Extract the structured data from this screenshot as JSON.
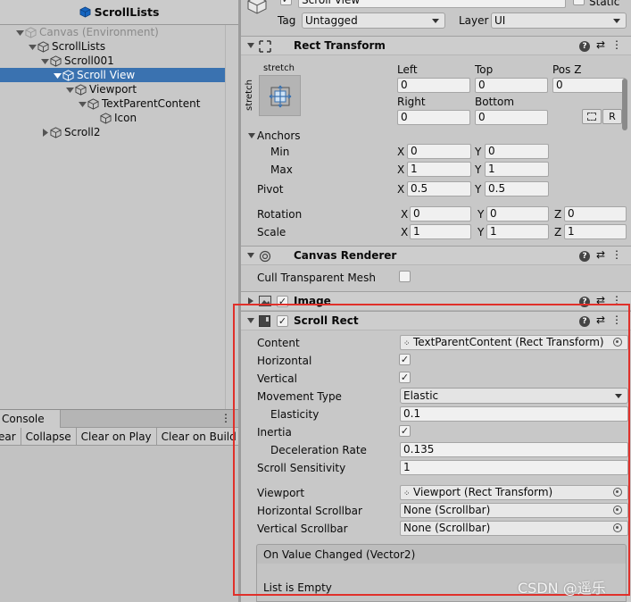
{
  "hierarchy": {
    "title": "ScrollLists",
    "items": [
      {
        "label": "Canvas (Environment)",
        "depth": 1,
        "expanded": true,
        "dim": true,
        "selected": false
      },
      {
        "label": "ScrollLists",
        "depth": 2,
        "expanded": true,
        "dim": false,
        "selected": false
      },
      {
        "label": "Scroll001",
        "depth": 3,
        "expanded": true,
        "dim": false,
        "selected": false
      },
      {
        "label": "Scroll View",
        "depth": 4,
        "expanded": true,
        "dim": false,
        "selected": true
      },
      {
        "label": "Viewport",
        "depth": 5,
        "expanded": true,
        "dim": false,
        "selected": false
      },
      {
        "label": "TextParentContent",
        "depth": 6,
        "expanded": true,
        "dim": false,
        "selected": false
      },
      {
        "label": "Icon",
        "depth": 7,
        "expanded": null,
        "dim": false,
        "selected": false
      },
      {
        "label": "Scroll2",
        "depth": 3,
        "expanded": false,
        "dim": false,
        "selected": false
      }
    ]
  },
  "console": {
    "tab_label": "Console",
    "toolbar": [
      "ear",
      "Collapse",
      "Clear on Play",
      "Clear on Build"
    ]
  },
  "inspector": {
    "object_name": "Scroll View",
    "static_label": "Static",
    "tag_label": "Tag",
    "tag_value": "Untagged",
    "layer_label": "Layer",
    "layer_value": "UI",
    "rect_transform": {
      "title": "Rect Transform",
      "anchor_preset_top": "stretch",
      "anchor_preset_side": "stretch",
      "left_label": "Left",
      "left": "0",
      "top_label": "Top",
      "top": "0",
      "posz_label": "Pos Z",
      "posz": "0",
      "right_label": "Right",
      "right": "0",
      "bottom_label": "Bottom",
      "bottom": "0",
      "r_button": "R",
      "anchors_label": "Anchors",
      "min_label": "Min",
      "min_x": "0",
      "min_y": "0",
      "max_label": "Max",
      "max_x": "1",
      "max_y": "1",
      "pivot_label": "Pivot",
      "pivot_x": "0.5",
      "pivot_y": "0.5",
      "rotation_label": "Rotation",
      "rot_x": "0",
      "rot_y": "0",
      "rot_z": "0",
      "scale_label": "Scale",
      "scale_x": "1",
      "scale_y": "1",
      "scale_z": "1",
      "x": "X",
      "y": "Y",
      "z": "Z"
    },
    "canvas_renderer": {
      "title": "Canvas Renderer",
      "cull_label": "Cull Transparent Mesh",
      "cull_checked": false
    },
    "image": {
      "title": "Image",
      "enabled": true
    },
    "scroll_rect": {
      "title": "Scroll Rect",
      "enabled": true,
      "content_label": "Content",
      "content_value": "TextParentContent (Rect Transform)",
      "horizontal_label": "Horizontal",
      "horizontal_checked": true,
      "vertical_label": "Vertical",
      "vertical_checked": true,
      "movement_label": "Movement Type",
      "movement_value": "Elastic",
      "elasticity_label": "Elasticity",
      "elasticity_value": "0.1",
      "inertia_label": "Inertia",
      "inertia_checked": true,
      "decel_label": "Deceleration Rate",
      "decel_value": "0.135",
      "sensitivity_label": "Scroll Sensitivity",
      "sensitivity_value": "1",
      "viewport_label": "Viewport",
      "viewport_value": "Viewport (Rect Transform)",
      "hscroll_label": "Horizontal Scrollbar",
      "hscroll_value": "None (Scrollbar)",
      "vscroll_label": "Vertical Scrollbar",
      "vscroll_value": "None (Scrollbar)",
      "event_label": "On Value Changed (Vector2)",
      "event_empty": "List is Empty"
    }
  },
  "watermark": "CSDN @遥乐",
  "colors": {
    "selection": "#3a72b0",
    "highlight_box": "#e0302a"
  }
}
